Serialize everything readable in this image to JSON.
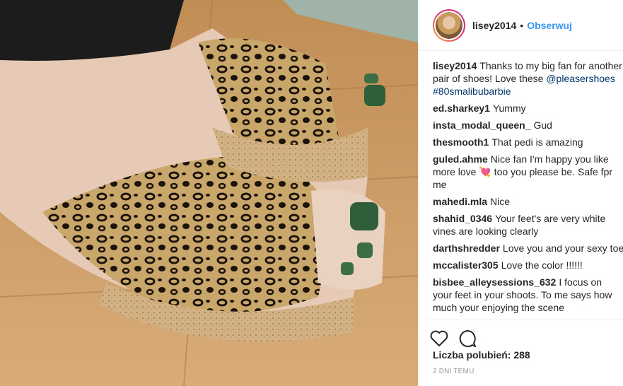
{
  "post": {
    "username": "lisey2014",
    "separator": "•",
    "follow_label": "Obserwuj",
    "caption": {
      "user": "lisey2014",
      "text": "Thanks to my big fan for another pair of shoes! Love these ",
      "mention": "@pleasershoes",
      "hashtag": "#80smalibubarbie"
    },
    "comments": [
      {
        "user": "ed.sharkey1",
        "text": "Yummy"
      },
      {
        "user": "insta_modal_queen_",
        "text": "Gud"
      },
      {
        "user": "thesmooth1",
        "text": "That pedi is amazing"
      },
      {
        "user": "guled.ahme",
        "text": "Nice fan I'm happy you like more love 💘 too you please be. Safe fpr me"
      },
      {
        "user": "mahedi.mla",
        "text": "Nice"
      },
      {
        "user": "shahid_0346",
        "text": "Your feet's are very white vines are looking clearly"
      },
      {
        "user": "darthshredder",
        "text": "Love you and your sexy toes"
      },
      {
        "user": "mccalister305",
        "text": "Love the color !!!!!!"
      },
      {
        "user": "bisbee_alleysessions_632",
        "text": "I focus on your feet in your shoots. To me says how much your enjoying the scene"
      }
    ],
    "likes_label": "Liczba polubień: 288",
    "timestamp": "2 DNI TEMU",
    "icons": {
      "like": "heart-icon",
      "comment": "comment-bubble-icon"
    }
  },
  "colors": {
    "accent": "#3897f0",
    "text": "#262626",
    "muted": "#999999"
  }
}
